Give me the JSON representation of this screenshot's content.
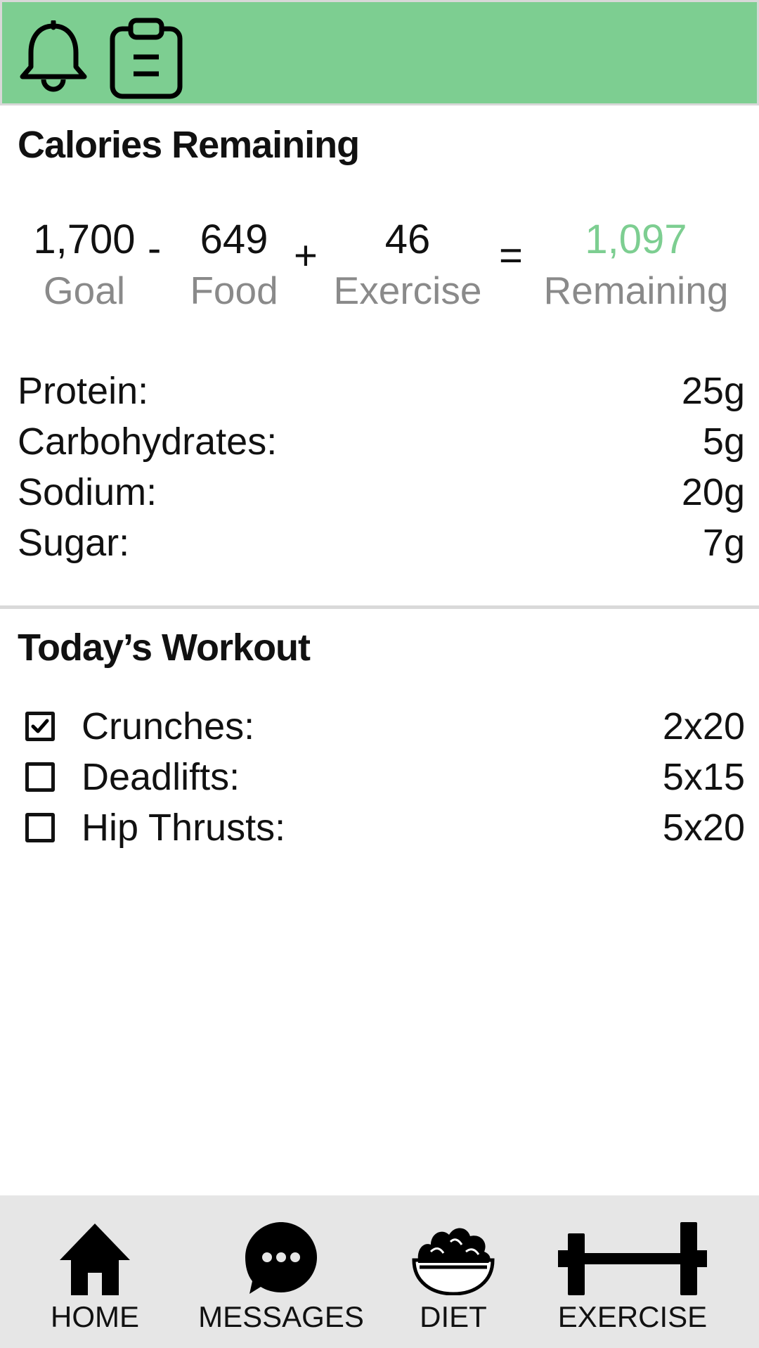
{
  "header": {
    "background": "#7dce91",
    "icons": [
      "bell-icon",
      "clipboard-icon"
    ]
  },
  "calories": {
    "title": "Calories Remaining",
    "goal_value": "1,700",
    "goal_label": "Goal",
    "minus_op": "-",
    "food_value": "649",
    "food_label": "Food",
    "plus_op": "+",
    "exercise_value": "46",
    "exercise_label": "Exercise",
    "equals_op": "=",
    "remaining_value": "1,097",
    "remaining_label": "Remaining",
    "remaining_color": "#7dce91"
  },
  "nutrients": [
    {
      "label": "Protein:",
      "value": "25g"
    },
    {
      "label": "Carbohydrates:",
      "value": "5g"
    },
    {
      "label": "Sodium:",
      "value": "20g"
    },
    {
      "label": "Sugar:",
      "value": "7g"
    }
  ],
  "workout": {
    "title": "Today’s Workout",
    "items": [
      {
        "label": "Crunches:",
        "value": "2x20",
        "checked": true
      },
      {
        "label": "Deadlifts:",
        "value": "5x15",
        "checked": false
      },
      {
        "label": "Hip Thrusts:",
        "value": "5x20",
        "checked": false
      }
    ]
  },
  "bottom_nav": {
    "background": "#e6e6e6",
    "items": [
      {
        "label": "HOME",
        "icon": "home-icon"
      },
      {
        "label": "MESSAGES",
        "icon": "chat-bubble-icon"
      },
      {
        "label": "DIET",
        "icon": "salad-bowl-icon"
      },
      {
        "label": "EXERCISE",
        "icon": "dumbbell-icon"
      }
    ]
  }
}
